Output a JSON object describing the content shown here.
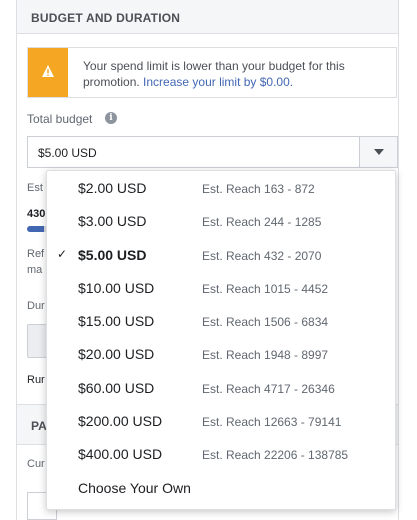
{
  "section": {
    "title": "BUDGET AND DURATION"
  },
  "warning": {
    "text": "Your spend limit is lower than your budget for this promotion.",
    "link": "Increase your limit by $0.00."
  },
  "budget": {
    "label": "Total budget",
    "info_icon": "info-icon",
    "selected_value": "$5.00 USD"
  },
  "behind": {
    "est_label": "Est",
    "reach_partial": "430",
    "progress_fraction": 0.55,
    "ref_line1": "Ref",
    "ref_line2": "ma",
    "duration_label": "Dur",
    "run_label": "Rur",
    "payment_header": "PA",
    "currency_label": "Cur"
  },
  "dropdown": {
    "options": [
      {
        "amount": "$2.00 USD",
        "reach": "Est. Reach 163 - 872",
        "selected": false
      },
      {
        "amount": "$3.00 USD",
        "reach": "Est. Reach 244 - 1285",
        "selected": false
      },
      {
        "amount": "$5.00 USD",
        "reach": "Est. Reach 432 - 2070",
        "selected": true
      },
      {
        "amount": "$10.00 USD",
        "reach": "Est. Reach 1015 - 4452",
        "selected": false
      },
      {
        "amount": "$15.00 USD",
        "reach": "Est. Reach 1506 - 6834",
        "selected": false
      },
      {
        "amount": "$20.00 USD",
        "reach": "Est. Reach 1948 - 8997",
        "selected": false
      },
      {
        "amount": "$60.00 USD",
        "reach": "Est. Reach 4717 - 26346",
        "selected": false
      },
      {
        "amount": "$200.00 USD",
        "reach": "Est. Reach 12663 - 79141",
        "selected": false
      },
      {
        "amount": "$400.00 USD",
        "reach": "Est. Reach 22206 - 138785",
        "selected": false
      },
      {
        "amount": "Choose Your Own",
        "reach": "",
        "selected": false
      }
    ]
  },
  "colors": {
    "accent": "#4267b2",
    "warning": "#f5a623"
  }
}
